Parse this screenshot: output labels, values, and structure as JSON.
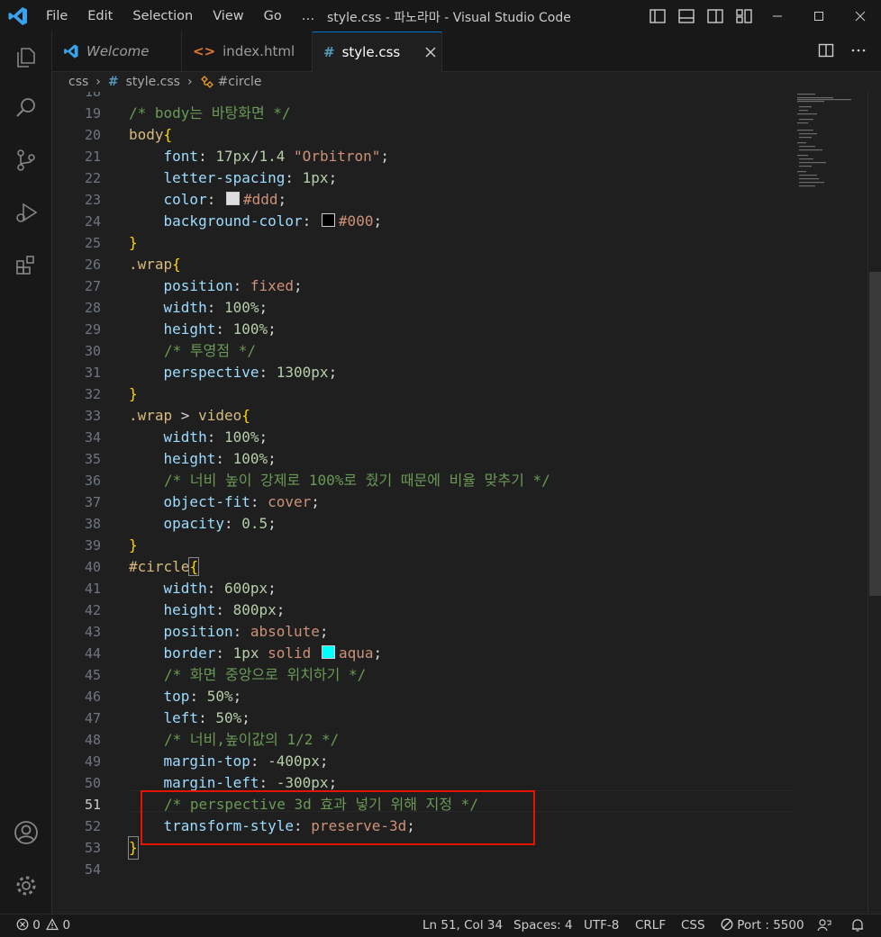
{
  "titlebar": {
    "menu": [
      "File",
      "Edit",
      "Selection",
      "View",
      "Go",
      "…"
    ],
    "title": "style.css - 파노라마 - Visual Studio Code"
  },
  "tabs": [
    {
      "label": "Welcome",
      "icon": "vscode-icon"
    },
    {
      "label": "index.html",
      "icon": "html-icon"
    },
    {
      "label": "style.css",
      "icon": "css-hash-icon"
    }
  ],
  "breadcrumb": {
    "folder": "css",
    "file": "style.css",
    "symbol": "#circle"
  },
  "editor": {
    "top_partial_line": "18",
    "lines": [
      {
        "n": "19",
        "text": "/* body는 바탕화면 */"
      },
      {
        "n": "20",
        "text": "body{"
      },
      {
        "n": "21",
        "text": "font: 17px/1.4 \"Orbitron\";"
      },
      {
        "n": "22",
        "text": "letter-spacing: 1px;"
      },
      {
        "n": "23",
        "text": "color: #ddd;"
      },
      {
        "n": "24",
        "text": "background-color: #000;"
      },
      {
        "n": "25",
        "text": "}"
      },
      {
        "n": "26",
        "text": ".wrap{"
      },
      {
        "n": "27",
        "text": "position: fixed;"
      },
      {
        "n": "28",
        "text": "width: 100%;"
      },
      {
        "n": "29",
        "text": "height: 100%;"
      },
      {
        "n": "30",
        "text": "/* 투영점 */"
      },
      {
        "n": "31",
        "text": "perspective: 1300px;"
      },
      {
        "n": "32",
        "text": "}"
      },
      {
        "n": "33",
        "text": ".wrap > video{"
      },
      {
        "n": "34",
        "text": "width: 100%;"
      },
      {
        "n": "35",
        "text": "height: 100%;"
      },
      {
        "n": "36",
        "text": "/* 너비 높이 강제로 100%로 줬기 때문에 비율 맞추기 */"
      },
      {
        "n": "37",
        "text": "object-fit: cover;"
      },
      {
        "n": "38",
        "text": "opacity: 0.5;"
      },
      {
        "n": "39",
        "text": "}"
      },
      {
        "n": "40",
        "text": "#circle{"
      },
      {
        "n": "41",
        "text": "width: 600px;"
      },
      {
        "n": "42",
        "text": "height: 800px;"
      },
      {
        "n": "43",
        "text": "position: absolute;"
      },
      {
        "n": "44",
        "text": "border: 1px solid aqua;"
      },
      {
        "n": "45",
        "text": "/* 화면 중앙으로 위치하기 */"
      },
      {
        "n": "46",
        "text": "top: 50%;"
      },
      {
        "n": "47",
        "text": "left: 50%;"
      },
      {
        "n": "48",
        "text": "/* 너비,높이값의 1/2 */"
      },
      {
        "n": "49",
        "text": "margin-top: -400px;"
      },
      {
        "n": "50",
        "text": "margin-left: -300px;"
      },
      {
        "n": "51",
        "text": "/* perspective 3d 효과 넣기 위해 지정 */"
      },
      {
        "n": "52",
        "text": "transform-style: preserve-3d;"
      },
      {
        "n": "53",
        "text": "}"
      },
      {
        "n": "54",
        "text": ""
      }
    ],
    "current_line": "51"
  },
  "statusbar": {
    "errors": "0",
    "warnings": "0",
    "position": "Ln 51, Col 34",
    "spaces": "Spaces: 4",
    "encoding": "UTF-8",
    "eol": "CRLF",
    "language": "CSS",
    "port": "Port : 5500"
  },
  "colors": {
    "accent": "#0078d4",
    "highlight_box": "#e51400",
    "swatch_ddd": "#dddddd",
    "swatch_000": "#000000",
    "swatch_aqua": "#00ffff"
  }
}
